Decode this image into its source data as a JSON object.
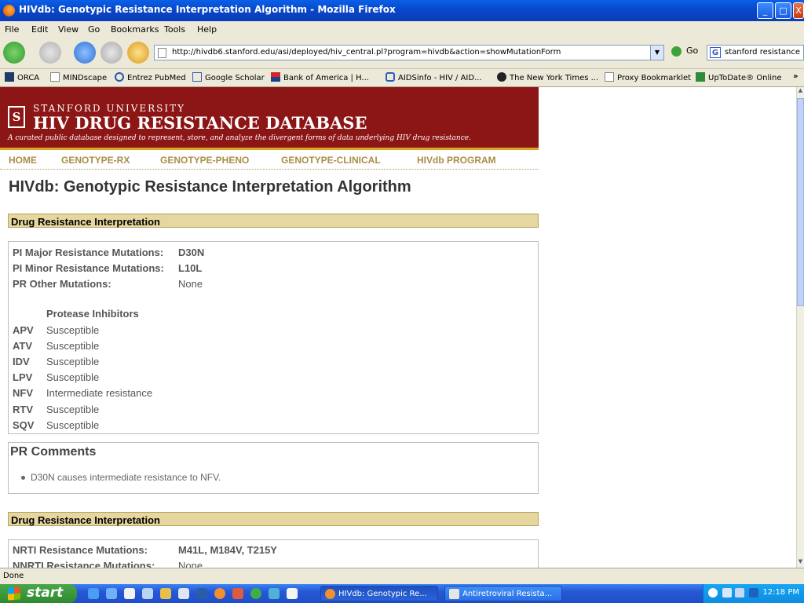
{
  "window": {
    "title": "HIVdb: Genotypic Resistance Interpretation Algorithm - Mozilla Firefox",
    "controls": {
      "minimize": "_",
      "maximize": "□",
      "close": "X"
    }
  },
  "menu": [
    "File",
    "Edit",
    "View",
    "Go",
    "Bookmarks",
    "Tools",
    "Help"
  ],
  "navigation": {
    "url": "http://hivdb6.stanford.edu/asi/deployed/hiv_central.pl?program=hivdb&action=showMutationForm",
    "go_label": "Go",
    "search_value": "stanford resistance",
    "dropdown_glyph": "▼"
  },
  "bookmarks": [
    {
      "label": "ORCA",
      "icon": "orca-icon"
    },
    {
      "label": "MINDscape",
      "icon": "page-icon"
    },
    {
      "label": "Entrez PubMed",
      "icon": "ncbi-icon"
    },
    {
      "label": "Google Scholar",
      "icon": "google-icon"
    },
    {
      "label": "Bank of America | H...",
      "icon": "bofa-icon"
    },
    {
      "label": "AIDSinfo - HIV / AID...",
      "icon": "aidsinfo-icon"
    },
    {
      "label": "The New York Times ...",
      "icon": "nyt-icon"
    },
    {
      "label": "Proxy Bookmarklet",
      "icon": "page-icon"
    },
    {
      "label": "UpToDate® Online",
      "icon": "uptodate-icon"
    },
    {
      "label": "»",
      "icon": "chevron-more-icon"
    }
  ],
  "banner": {
    "university": "STANFORD UNIVERSITY",
    "database": "HIV DRUG RESISTANCE DATABASE",
    "tagline": "A curated public database designed to represent, store, and analyze the divergent forms of data underlying HIV drug resistance.",
    "seal_letter": "S"
  },
  "site_nav": [
    "HOME",
    "GENOTYPE-RX",
    "GENOTYPE-PHENO",
    "GENOTYPE-CLINICAL",
    "HIVdb PROGRAM"
  ],
  "page_title": "HIVdb: Genotypic Resistance Interpretation Algorithm",
  "pr_section": {
    "heading": "Drug Resistance Interpretation",
    "mutations": [
      {
        "label": "PI Major Resistance Mutations:",
        "value": "D30N"
      },
      {
        "label": "PI Minor Resistance Mutations:",
        "value": "L10L"
      },
      {
        "label": "PR Other Mutations:",
        "value": "None"
      }
    ],
    "class_heading": "Protease Inhibitors",
    "drugs": [
      {
        "code": "APV",
        "result": "Susceptible"
      },
      {
        "code": "ATV",
        "result": "Susceptible"
      },
      {
        "code": "IDV",
        "result": "Susceptible"
      },
      {
        "code": "LPV",
        "result": "Susceptible"
      },
      {
        "code": "NFV",
        "result": "Intermediate resistance"
      },
      {
        "code": "RTV",
        "result": "Susceptible"
      },
      {
        "code": "SQV",
        "result": "Susceptible"
      }
    ],
    "comments_heading": "PR Comments",
    "comments": [
      "D30N causes intermediate resistance to NFV."
    ]
  },
  "rt_section": {
    "heading": "Drug Resistance Interpretation",
    "mutations": [
      {
        "label": "NRTI Resistance Mutations:",
        "value": "M41L, M184V, T215Y"
      },
      {
        "label": "NNRTI Resistance Mutations:",
        "value": "None"
      }
    ]
  },
  "status": "Done",
  "taskbar": {
    "start_label": "start",
    "tasks": [
      "HIVdb: Genotypic Re...",
      "Antiretroviral Resista..."
    ],
    "clock": "12:18 PM"
  },
  "colors": {
    "banner_red": "#8c1515",
    "nav_gold": "#a98e46",
    "section_tan": "#e6d7a0"
  }
}
